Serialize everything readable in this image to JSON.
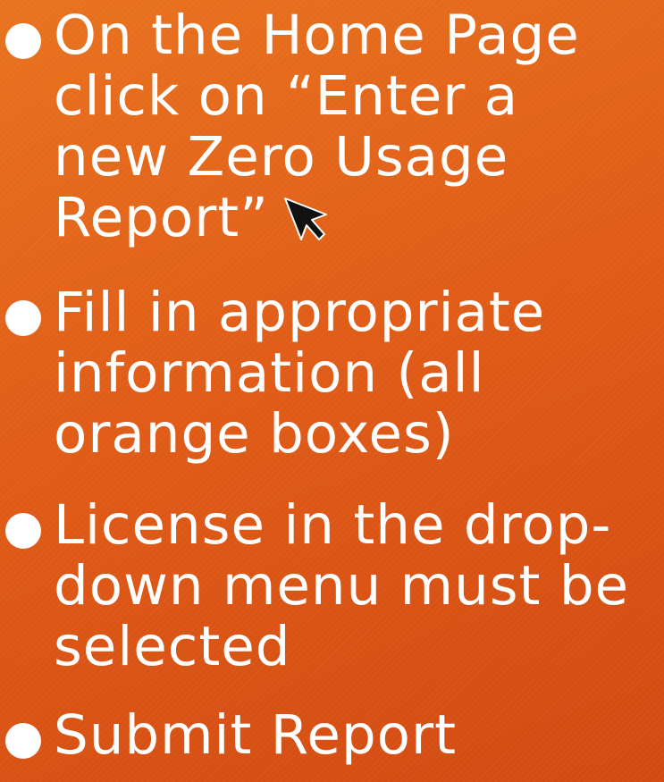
{
  "slide": {
    "background_color": "#e05c17",
    "text_color": "#ffffff",
    "bullets": [
      {
        "lines": [
          "On the Home Page",
          "click on “Enter a",
          "new Zero Usage",
          "Report”"
        ],
        "icon": "mouse-pointer-arrow-icon"
      },
      {
        "lines": [
          "Fill in appropriate",
          "information (all",
          "orange boxes)"
        ]
      },
      {
        "lines": [
          "License in the drop-",
          "down menu must be",
          "selected"
        ]
      },
      {
        "lines": [
          "Submit Report"
        ]
      }
    ]
  }
}
